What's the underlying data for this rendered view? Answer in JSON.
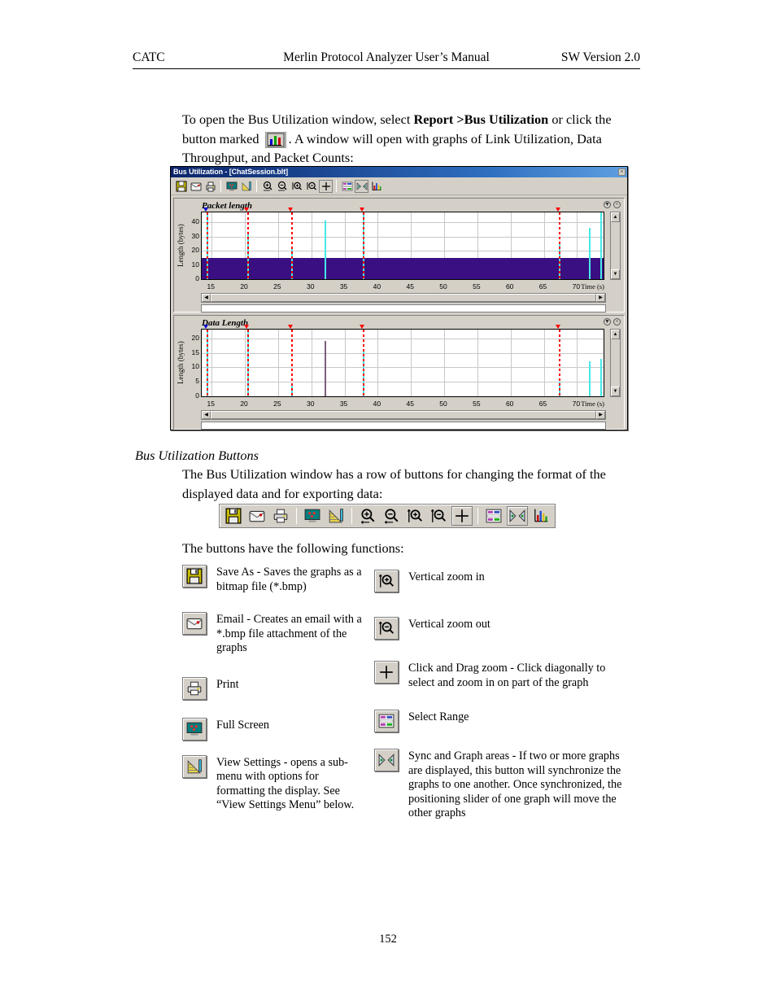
{
  "header": {
    "left": "CATC",
    "center": "Merlin Protocol Analyzer User’s Manual",
    "right": "SW Version 2.0"
  },
  "page_number": "152",
  "intro": {
    "text_1": "To open the Bus Utilization window, select ",
    "bold_1": "Report >Bus Utilization",
    "text_2": " or click the button marked ",
    "icon_name": "bar-chart-icon",
    "text_3": ".  A window will open with graphs of Link Utilization, Data Throughput, and Packet Counts:"
  },
  "section": {
    "heading": "Bus Utilization Buttons",
    "paragraph": "The Bus Utilization window has a row of buttons for changing the format of the displayed data and for exporting data:",
    "functions_intro": "The buttons have the following functions:"
  },
  "app_window": {
    "title": "Bus Utilization - [ChatSession.blt]",
    "close_label": "×",
    "toolbar": [
      {
        "name": "save-as-button",
        "icon": "floppy-disk-icon"
      },
      {
        "name": "email-button",
        "icon": "envelope-icon"
      },
      {
        "name": "print-button",
        "icon": "printer-icon"
      },
      {
        "name": "full-screen-button",
        "icon": "monitor-icon"
      },
      {
        "name": "view-settings-button",
        "icon": "ruler-graph-icon"
      },
      {
        "name": "zoom-in-button",
        "icon": "magnifier-plus-icon"
      },
      {
        "name": "zoom-out-button",
        "icon": "magnifier-minus-icon"
      },
      {
        "name": "vertical-zoom-in-button",
        "icon": "vertical-magnifier-plus-icon"
      },
      {
        "name": "vertical-zoom-out-button",
        "icon": "vertical-magnifier-minus-icon"
      },
      {
        "name": "click-drag-zoom-button",
        "icon": "plus-crosshair-icon"
      },
      {
        "name": "select-range-button",
        "icon": "range-grid-icon"
      },
      {
        "name": "sync-graphs-button",
        "icon": "sync-arrows-icon"
      },
      {
        "name": "graph-areas-button",
        "icon": "colored-bars-icon"
      }
    ],
    "scroll": {
      "up": "▲",
      "down": "▼",
      "left": "◀",
      "right": "▶"
    },
    "panel_icons": {
      "collapse": "▼",
      "close": "×"
    }
  },
  "chart_data": [
    {
      "type": "line",
      "title": "Packet length",
      "xlabel": "Time (s)",
      "ylabel": "Length (bytes)",
      "xlim": [
        13.5,
        74
      ],
      "ylim": [
        0,
        47
      ],
      "xticks": [
        15,
        20,
        25,
        30,
        35,
        40,
        45,
        50,
        55,
        60,
        65,
        70
      ],
      "yticks": [
        0,
        10,
        20,
        30,
        40
      ],
      "grid": true,
      "baseline_fill": 15,
      "baseline_fill_color": "#3a0f82",
      "spike_color": "#46e9e9",
      "marker_color": "#ff0000",
      "spikes": [
        {
          "x": 14.2,
          "y": 47
        },
        {
          "x": 20.4,
          "y": 33
        },
        {
          "x": 27.0,
          "y": 22
        },
        {
          "x": 32.0,
          "y": 41
        },
        {
          "x": 37.8,
          "y": 47
        },
        {
          "x": 67.3,
          "y": 26
        },
        {
          "x": 71.8,
          "y": 36
        },
        {
          "x": 73.5,
          "y": 47
        }
      ],
      "markers": [
        14.2,
        20.4,
        27.0,
        37.8,
        67.3
      ],
      "marker_triangles": [
        {
          "x": 14.2,
          "color": "#0000cc"
        },
        {
          "x": 20.4,
          "color": "#ff0000"
        },
        {
          "x": 27.0,
          "color": "#ff0000"
        },
        {
          "x": 37.8,
          "color": "#ff0000"
        },
        {
          "x": 67.3,
          "color": "#ff0000"
        }
      ]
    },
    {
      "type": "line",
      "title": "Data Length",
      "xlabel": "Time (s)",
      "ylabel": "Length (bytes)",
      "xlim": [
        13.5,
        74
      ],
      "ylim": [
        0,
        23
      ],
      "xticks": [
        15,
        20,
        25,
        30,
        35,
        40,
        45,
        50,
        55,
        60,
        65,
        70
      ],
      "yticks": [
        0,
        5,
        10,
        15,
        20
      ],
      "grid": true,
      "baseline_fill": 0,
      "spike_color": "#46e9e9",
      "marker_color": "#ff0000",
      "spikes": [
        {
          "x": 14.2,
          "y": 23
        },
        {
          "x": 20.4,
          "y": 23
        },
        {
          "x": 27.0,
          "y": 4
        },
        {
          "x": 32.0,
          "y": 19,
          "color": "#7a5f7a"
        },
        {
          "x": 37.8,
          "y": 16
        },
        {
          "x": 67.3,
          "y": 5
        },
        {
          "x": 71.8,
          "y": 12
        },
        {
          "x": 73.5,
          "y": 13
        }
      ],
      "markers": [
        14.2,
        20.4,
        27.0,
        37.8,
        67.3
      ],
      "marker_triangles": [
        {
          "x": 14.2,
          "color": "#0000cc"
        },
        {
          "x": 20.4,
          "color": "#ff0000"
        },
        {
          "x": 27.0,
          "color": "#ff0000"
        },
        {
          "x": 37.8,
          "color": "#ff0000"
        },
        {
          "x": 67.3,
          "color": "#ff0000"
        }
      ]
    }
  ],
  "button_strip": [
    {
      "name": "save-as-button",
      "icon": "floppy-disk-icon",
      "framed": false
    },
    {
      "name": "email-button",
      "icon": "envelope-icon",
      "framed": false
    },
    {
      "name": "print-button",
      "icon": "printer-icon",
      "framed": false
    },
    {
      "name": "full-screen-button",
      "icon": "monitor-icon",
      "framed": false
    },
    {
      "name": "view-settings-button",
      "icon": "ruler-graph-icon",
      "framed": false
    },
    {
      "name": "zoom-in-button",
      "icon": "magnifier-plus-icon",
      "framed": false
    },
    {
      "name": "zoom-out-button",
      "icon": "magnifier-minus-icon",
      "framed": false
    },
    {
      "name": "vertical-zoom-in-button",
      "icon": "vertical-magnifier-plus-icon",
      "framed": false
    },
    {
      "name": "vertical-zoom-out-button",
      "icon": "vertical-magnifier-minus-icon",
      "framed": false
    },
    {
      "name": "click-drag-zoom-button",
      "icon": "plus-crosshair-icon",
      "framed": true
    },
    {
      "name": "select-range-button",
      "icon": "range-grid-icon",
      "framed": false
    },
    {
      "name": "sync-graphs-button",
      "icon": "sync-arrows-icon",
      "framed": true
    },
    {
      "name": "graph-areas-button",
      "icon": "colored-bars-icon",
      "framed": false
    }
  ],
  "functions_left": [
    {
      "icon": "floppy-disk-icon",
      "name": "save-as",
      "text": "Save As - Saves the graphs as a bitmap file (*.bmp)"
    },
    {
      "icon": "envelope-icon",
      "name": "email",
      "text": "Email - Creates an email with a *.bmp file attachment of the graphs"
    },
    {
      "icon": "printer-icon",
      "name": "print",
      "text": "Print"
    },
    {
      "icon": "monitor-icon",
      "name": "full-screen",
      "text": "Full Screen"
    },
    {
      "icon": "ruler-graph-icon",
      "name": "view-settings",
      "text": "View Settings - opens a sub-menu with options for formatting the display.  See “View Settings Menu” below."
    }
  ],
  "functions_right": [
    {
      "icon": "vertical-magnifier-plus-icon",
      "name": "vertical-zoom-in",
      "text": "Vertical zoom in"
    },
    {
      "icon": "vertical-magnifier-minus-icon",
      "name": "vertical-zoom-out",
      "text": "Vertical zoom out"
    },
    {
      "icon": "plus-crosshair-icon",
      "name": "click-drag-zoom",
      "text": "Click and Drag zoom - Click diagonally to select and zoom in on part of the graph"
    },
    {
      "icon": "range-grid-icon",
      "name": "select-range",
      "text": "Select Range"
    },
    {
      "icon": "sync-arrows-icon",
      "name": "sync-and-graph-areas",
      "text": "Sync and Graph areas - If two or more graphs are displayed, this button will synchronize the graphs to one another.  Once synchronized, the positioning slider of one graph will move the other graphs"
    }
  ]
}
